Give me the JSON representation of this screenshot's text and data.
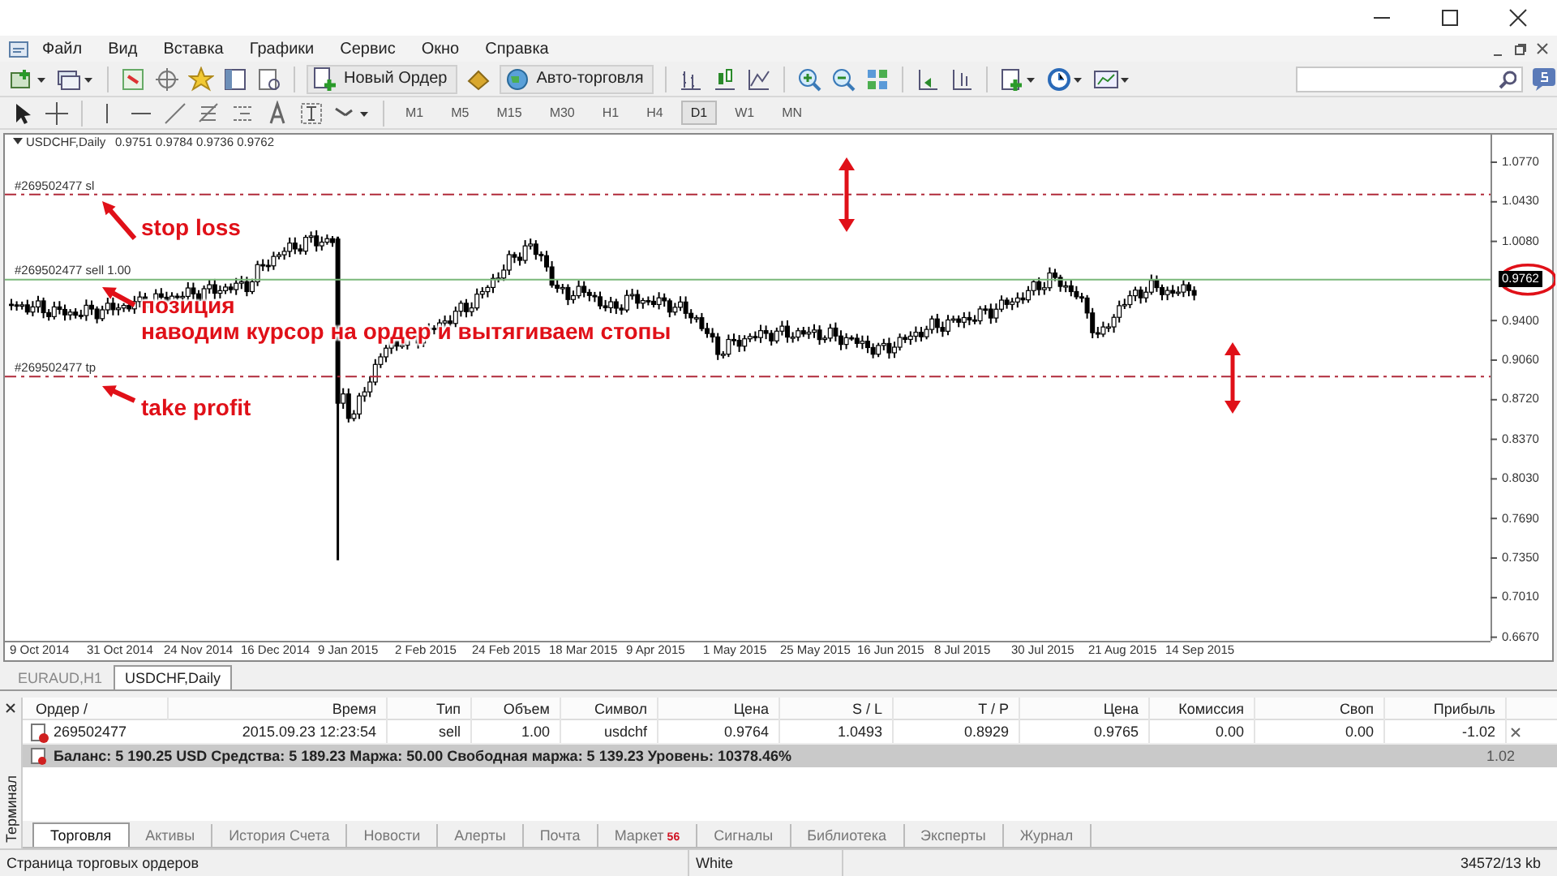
{
  "menu": [
    "Файл",
    "Вид",
    "Вставка",
    "Графики",
    "Сервис",
    "Окно",
    "Справка"
  ],
  "toolbar": {
    "new_order": "Новый Ордер",
    "auto_trading": "Авто-торговля"
  },
  "timeframes": [
    {
      "label": "M1",
      "selected": false
    },
    {
      "label": "M5",
      "selected": false
    },
    {
      "label": "M15",
      "selected": false
    },
    {
      "label": "M30",
      "selected": false
    },
    {
      "label": "H1",
      "selected": false
    },
    {
      "label": "H4",
      "selected": false
    },
    {
      "label": "D1",
      "selected": true
    },
    {
      "label": "W1",
      "selected": false
    },
    {
      "label": "MN",
      "selected": false
    }
  ],
  "chart": {
    "symbol": "USDCHF,Daily",
    "ohlc": "0.9751 0.9784 0.9736 0.9762",
    "order_lines": [
      {
        "kind": "sl",
        "label": "#269502477 sl"
      },
      {
        "kind": "entry",
        "label": "#269502477 sell 1.00"
      },
      {
        "kind": "tp",
        "label": "#269502477 tp"
      }
    ],
    "price_axis": [
      "1.0770",
      "1.0430",
      "1.0080",
      "0.9400",
      "0.9060",
      "0.8720",
      "0.8370",
      "0.8030",
      "0.7690",
      "0.7350",
      "0.7010",
      "0.6670"
    ],
    "current_price": "0.9762",
    "date_axis": [
      "9 Oct 2014",
      "31 Oct 2014",
      "24 Nov 2014",
      "16 Dec 2014",
      "9 Jan 2015",
      "2 Feb 2015",
      "24 Feb 2015",
      "18 Mar 2015",
      "9 Apr 2015",
      "1 May 2015",
      "25 May 2015",
      "16 Jun 2015",
      "8 Jul 2015",
      "30 Jul 2015",
      "21 Aug 2015",
      "14 Sep 2015"
    ],
    "annotations": [
      {
        "text": "stop loss"
      },
      {
        "text": "позиция"
      },
      {
        "text": "наводим курсор на ордер и вытягиваем стопы"
      },
      {
        "text": "take profit"
      }
    ]
  },
  "chart_tabs": [
    {
      "label": "EURAUD,H1",
      "selected": false
    },
    {
      "label": "USDCHF,Daily",
      "selected": true
    }
  ],
  "terminal": {
    "side_label": "Терминал",
    "columns": [
      "Ордер  /",
      "Время",
      "Тип",
      "Объем",
      "Символ",
      "Цена",
      "S / L",
      "T / P",
      "Цена",
      "Комиссия",
      "Своп",
      "Прибыль"
    ],
    "rows": [
      {
        "cells": [
          "269502477",
          "2015.09.23 12:23:54",
          "sell",
          "1.00",
          "usdchf",
          "0.9764",
          "1.0493",
          "0.8929",
          "0.9765",
          "0.00",
          "0.00",
          "-1.02"
        ]
      }
    ],
    "summary": "Баланс: 5 190.25 USD  Средства: 5 189.23  Маржа: 50.00  Свободная маржа: 5 139.23  Уровень: 10378.46%",
    "summary_total": "1.02",
    "tabs": [
      {
        "label": "Торговля",
        "selected": true
      },
      {
        "label": "Активы",
        "selected": false
      },
      {
        "label": "История Счета",
        "selected": false
      },
      {
        "label": "Новости",
        "selected": false
      },
      {
        "label": "Алерты",
        "selected": false
      },
      {
        "label": "Почта",
        "selected": false
      },
      {
        "label": "Маркет",
        "badge": "56",
        "selected": false
      },
      {
        "label": "Сигналы",
        "selected": false
      },
      {
        "label": "Библиотека",
        "selected": false
      },
      {
        "label": "Эксперты",
        "selected": false
      },
      {
        "label": "Журнал",
        "selected": false
      }
    ]
  },
  "status_bar": [
    "Страница торговых ордеров",
    "White",
    "34572/13 kb"
  ]
}
